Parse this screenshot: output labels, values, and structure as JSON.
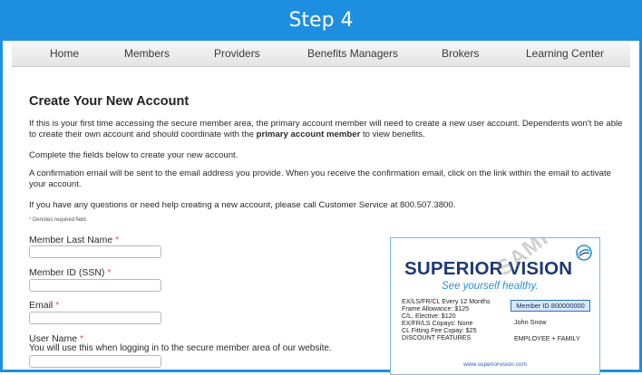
{
  "banner": {
    "title": "Step 4"
  },
  "nav": {
    "items": [
      "Home",
      "Members",
      "Providers",
      "Benefits Managers",
      "Brokers",
      "Learning Center"
    ]
  },
  "page": {
    "title": "Create Your New Account",
    "intro_1": "If this is your first time accessing the secure member area, the primary account member will need to create a new user account. Dependents won't be able to create their own account and should coordinate with the ",
    "intro_1_bold": "primary account member",
    "intro_1_end": " to view benefits.",
    "intro_2": "Complete the fields below to create your new account.",
    "intro_3": "A confirmation email will be sent to the email address you provide. When you receive the confirmation email, click on the link within the email to activate your account.",
    "intro_4": "If you have any questions or need help creating a new account, please call Customer Service at 800.507.3800.",
    "required_marker": "*",
    "required_note": " Denotes required field."
  },
  "form": {
    "last_name_label": "Member Last Name",
    "member_id_label": "Member ID (SSN)",
    "email_label": "Email",
    "username_label": "User Name",
    "username_hint": "You will use this when logging in to the secure member area of our website.",
    "required_marker": "*"
  },
  "card": {
    "brand": "SUPERIOR VISION",
    "tagline": "See yourself healthy.",
    "lines": [
      "EX/LS/FR/CL Every 12 Months",
      "Frame Allowance: $125",
      "C/L, Elective: $120",
      "EX/FR/LS Copays: None",
      "CL Fitting Fee Copay: $25",
      "DISCOUNT FEATURES"
    ],
    "member_id": "Member ID 800000000",
    "holder": "John Snow",
    "coverage": "EMPLOYEE + FAMILY",
    "url": "www.superiorvision.com",
    "watermark": "SAMPLE"
  },
  "colors": {
    "banner": "#1e8fe0",
    "brand": "#1d3a78",
    "accent": "#2a8fd6",
    "required": "#d9534f"
  },
  "icons": {
    "card_logo": "swirl-logo-icon"
  }
}
